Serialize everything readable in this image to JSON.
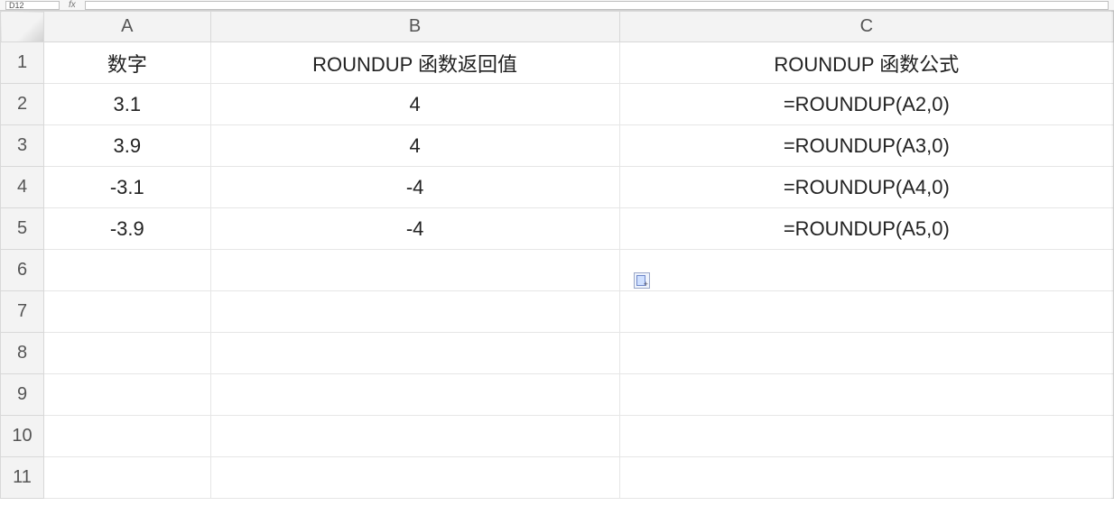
{
  "toolbar": {
    "name_box": "D12",
    "fx_label": "fx"
  },
  "columns": [
    "A",
    "B",
    "C"
  ],
  "row_numbers": [
    "1",
    "2",
    "3",
    "4",
    "5",
    "6",
    "7",
    "8",
    "9",
    "10",
    "11"
  ],
  "cells": {
    "r1": {
      "A": "数字",
      "B": "ROUNDUP 函数返回值",
      "C": "ROUNDUP 函数公式"
    },
    "r2": {
      "A": "3.1",
      "B": "4",
      "C": "=ROUNDUP(A2,0)"
    },
    "r3": {
      "A": "3.9",
      "B": "4",
      "C": "=ROUNDUP(A3,0)"
    },
    "r4": {
      "A": "-3.1",
      "B": "-4",
      "C": "=ROUNDUP(A4,0)"
    },
    "r5": {
      "A": "-3.9",
      "B": "-4",
      "C": "=ROUNDUP(A5,0)"
    },
    "r6": {
      "A": "",
      "B": "",
      "C": ""
    },
    "r7": {
      "A": "",
      "B": "",
      "C": ""
    },
    "r8": {
      "A": "",
      "B": "",
      "C": ""
    },
    "r9": {
      "A": "",
      "B": "",
      "C": ""
    },
    "r10": {
      "A": "",
      "B": "",
      "C": ""
    },
    "r11": {
      "A": "",
      "B": "",
      "C": ""
    }
  },
  "chart_data": {
    "type": "table",
    "title": "",
    "columns": [
      "数字",
      "ROUNDUP 函数返回值",
      "ROUNDUP 函数公式"
    ],
    "rows": [
      [
        "3.1",
        "4",
        "=ROUNDUP(A2,0)"
      ],
      [
        "3.9",
        "4",
        "=ROUNDUP(A3,0)"
      ],
      [
        "-3.1",
        "-4",
        "=ROUNDUP(A4,0)"
      ],
      [
        "-3.9",
        "-4",
        "=ROUNDUP(A5,0)"
      ]
    ]
  }
}
